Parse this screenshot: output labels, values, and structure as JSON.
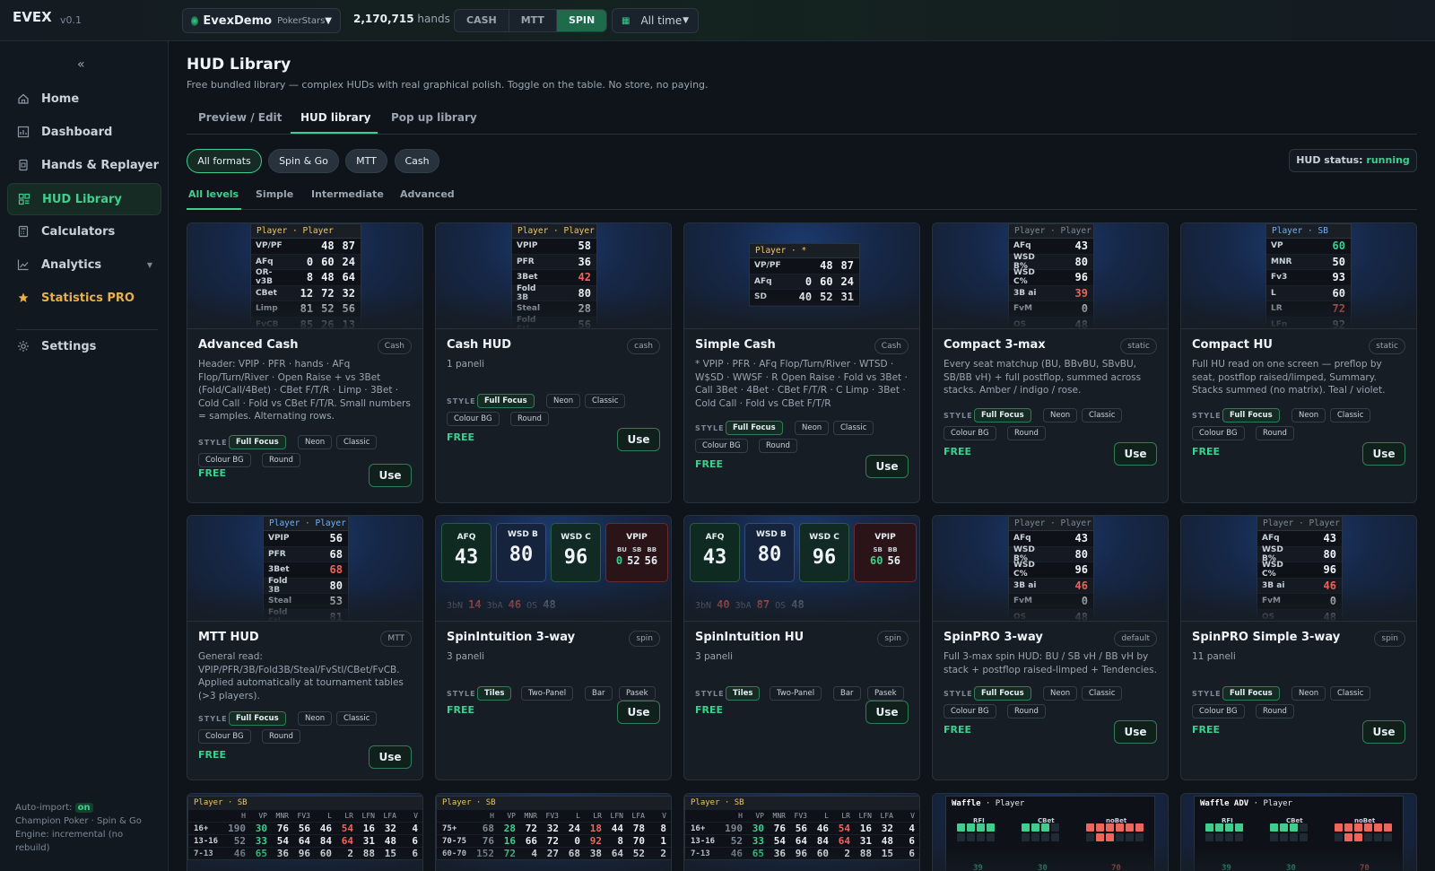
{
  "app": {
    "logo": "EVEX",
    "version": "v0.1"
  },
  "topbar": {
    "account_name": "EvexDemo",
    "account_site": "PokerStars",
    "hands_count": "2,170,715",
    "hands_label": "hands",
    "formats": [
      "CASH",
      "MTT",
      "SPIN"
    ],
    "active_format": "SPIN",
    "date_range": "All time"
  },
  "sidebar": {
    "items": [
      {
        "label": "Home",
        "icon": "home-icon"
      },
      {
        "label": "Dashboard",
        "icon": "dashboard-icon"
      },
      {
        "label": "Hands & Replayer",
        "icon": "replayer-icon"
      },
      {
        "label": "HUD Library",
        "icon": "hud-icon"
      },
      {
        "label": "Calculators",
        "icon": "calculator-icon"
      },
      {
        "label": "Analytics",
        "icon": "analytics-icon"
      },
      {
        "label": "Statistics PRO",
        "icon": "star-icon"
      },
      {
        "label": "Settings",
        "icon": "gear-icon"
      }
    ],
    "footer": {
      "auto_import_label": "Auto-import:",
      "auto_import_value": "on",
      "line2": "Champion Poker · Spin & Go",
      "line3": "Engine: incremental (no rebuild)"
    }
  },
  "page": {
    "title": "HUD Library",
    "subtitle": "Free bundled library — complex HUDs with real graphical polish. Toggle on the table. No store, no paying.",
    "tabs": [
      "Preview / Edit",
      "HUD library",
      "Pop up library"
    ],
    "format_filters": [
      "All formats",
      "Spin & Go",
      "MTT",
      "Cash"
    ],
    "hud_status_label": "HUD status:",
    "hud_status_value": "running",
    "levels": [
      "All levels",
      "Simple",
      "Intermediate",
      "Advanced"
    ]
  },
  "common": {
    "style_label": "STYLE",
    "free_label": "FREE",
    "use_label": "Use"
  },
  "cards": [
    {
      "title": "Advanced Cash",
      "tag": "Cash",
      "desc": "Header: VPIP · PFR · hands · AFq Flop/Turn/River · Open Raise + vs 3Bet (Fold/Call/4Bet) · CBet F/T/R · Limp · 3Bet · Cold Call · Fold vs CBet F/T/R. Small numbers = samples. Alternating rows.",
      "styles": [
        "Full Focus",
        "Neon",
        "Classic",
        "Colour BG",
        "Round"
      ],
      "hud": {
        "header": "Player · Player",
        "rows": [
          [
            "VP/PF",
            "48",
            "87"
          ],
          [
            "AFq",
            "0",
            "60",
            "24"
          ],
          [
            "OR-v3B",
            "8",
            "48",
            "64"
          ],
          [
            "CBet",
            "12",
            "72",
            "32"
          ],
          [
            "Limp",
            "81",
            "52",
            "56"
          ],
          [
            "FvCB",
            "85",
            "26",
            "13"
          ]
        ]
      }
    },
    {
      "title": "Cash HUD",
      "tag": "cash",
      "desc": "1 paneli",
      "styles": [
        "Full Focus",
        "Neon",
        "Classic",
        "Colour BG",
        "Round"
      ],
      "hud": {
        "header": "Player · Player",
        "rows": [
          [
            "VPIP",
            "58"
          ],
          [
            "PFR",
            "36"
          ],
          [
            "3Bet",
            "42"
          ],
          [
            "Fold 3B",
            "80"
          ],
          [
            "Steal",
            "28"
          ],
          [
            "Fold Stl",
            "56"
          ]
        ]
      }
    },
    {
      "title": "Simple Cash",
      "tag": "Cash",
      "desc": "* VPIP · PFR · AFq Flop/Turn/River · WTSD · W$SD · WWSF · R Open Raise · Fold vs 3Bet · Call 3Bet · 4Bet · CBet F/T/R · C Limp · 3Bet · Cold Call · Fold vs CBet F/T/R",
      "styles": [
        "Full Focus",
        "Neon",
        "Classic",
        "Colour BG",
        "Round"
      ],
      "hud": {
        "header": "Player · *",
        "rows": [
          [
            "VP/PF",
            "48",
            "87"
          ],
          [
            "AFq",
            "0",
            "60",
            "24"
          ],
          [
            "SD",
            "40",
            "52",
            "31"
          ]
        ]
      }
    },
    {
      "title": "Compact 3-max",
      "tag": "static",
      "desc": "Every seat matchup (BU, BBvBU, SBvBU, SB/BB vH) + full postflop, summed across stacks. Amber / indigo / rose.",
      "styles": [
        "Full Focus",
        "Neon",
        "Classic",
        "Colour BG",
        "Round"
      ],
      "hud": {
        "header": "Player · Player",
        "rows": [
          [
            "AFq",
            "43"
          ],
          [
            "WSD B%",
            "80"
          ],
          [
            "WSD C%",
            "96"
          ],
          [
            "3B ai",
            "39"
          ],
          [
            "FvM",
            "0"
          ],
          [
            "OS",
            "48"
          ]
        ]
      }
    },
    {
      "title": "Compact HU",
      "tag": "static",
      "desc": "Full HU read on one screen — preflop by seat, postflop raised/limped, Summary. Stacks summed (no matrix). Teal / violet.",
      "styles": [
        "Full Focus",
        "Neon",
        "Classic",
        "Colour BG",
        "Round"
      ],
      "hud": {
        "header": "Player · SB",
        "rows": [
          [
            "VP",
            "60"
          ],
          [
            "MNR",
            "50"
          ],
          [
            "Fv3",
            "93"
          ],
          [
            "L",
            "60"
          ],
          [
            "LR",
            "72"
          ],
          [
            "LFn",
            "92"
          ]
        ]
      }
    },
    {
      "title": "MTT HUD",
      "tag": "MTT",
      "desc": "General read: VPIP/PFR/3B/Fold3B/Steal/FvStl/CBet/FvCB. Applied automatically at tournament tables (>3 players).",
      "styles": [
        "Full Focus",
        "Neon",
        "Classic",
        "Colour BG",
        "Round"
      ],
      "hud": {
        "header": "Player · Player",
        "rows": [
          [
            "VPIP",
            "56"
          ],
          [
            "PFR",
            "68"
          ],
          [
            "3Bet",
            "68"
          ],
          [
            "Fold 3B",
            "80"
          ],
          [
            "Steal",
            "53"
          ],
          [
            "Fold Stl",
            "81"
          ]
        ]
      }
    },
    {
      "title": "SpinIntuition 3-way",
      "tag": "spin",
      "desc": "3 paneli",
      "styles": [
        "Tiles",
        "Two-Panel",
        "Bar",
        "Pasek"
      ],
      "tiles": {
        "afq": "43",
        "wsdb": "80",
        "wsdc": "96",
        "vpip_label": "VPIP",
        "bu": "0",
        "sb": "52",
        "bb": "56",
        "b3n": "14",
        "b3a": "46",
        "os": "48"
      }
    },
    {
      "title": "SpinIntuition HU",
      "tag": "spin",
      "desc": "3 paneli",
      "styles": [
        "Tiles",
        "Two-Panel",
        "Bar",
        "Pasek"
      ],
      "tiles": {
        "afq": "43",
        "wsdb": "80",
        "wsdc": "96",
        "vpip_label": "VPIP",
        "sb": "60",
        "bb": "56",
        "b3n": "40",
        "b3a": "87",
        "os": "48"
      }
    },
    {
      "title": "SpinPRO 3-way",
      "tag": "default",
      "desc": "Full 3-max spin HUD: BU / SB vH / BB vH by stack + postflop raised-limped + Tendencies.",
      "styles": [
        "Full Focus",
        "Neon",
        "Classic",
        "Colour BG",
        "Round"
      ],
      "hud": {
        "header": "Player · Player",
        "rows": [
          [
            "AFq",
            "43"
          ],
          [
            "WSD B%",
            "80"
          ],
          [
            "WSD C%",
            "96"
          ],
          [
            "3B ai",
            "46"
          ],
          [
            "FvM",
            "0"
          ],
          [
            "OS",
            "48"
          ]
        ]
      }
    },
    {
      "title": "SpinPRO Simple 3-way",
      "tag": "spin",
      "desc": "11 paneli",
      "styles": [
        "Full Focus",
        "Neon",
        "Classic",
        "Colour BG",
        "Round"
      ],
      "hud": {
        "header": "Player · Player",
        "rows": [
          [
            "AFq",
            "43"
          ],
          [
            "WSD B%",
            "80"
          ],
          [
            "WSD C%",
            "96"
          ],
          [
            "3B ai",
            "46"
          ],
          [
            "FvM",
            "0"
          ],
          [
            "OS",
            "48"
          ]
        ]
      }
    }
  ],
  "bottom_cards": [
    {
      "header": "Player · SB",
      "cols": [
        "H",
        "VP",
        "MNR",
        "FV3",
        "L",
        "LR",
        "LFN",
        "LFA",
        "V"
      ],
      "rows": [
        [
          "16+",
          "190",
          "30",
          "76",
          "56",
          "46",
          "54",
          "16",
          "32",
          "4"
        ],
        [
          "13-16",
          "52",
          "33",
          "54",
          "64",
          "84",
          "64",
          "31",
          "48",
          "6"
        ],
        [
          "7-13",
          "46",
          "65",
          "36",
          "96",
          "60",
          "2",
          "88",
          "15",
          "6"
        ]
      ]
    },
    {
      "header": "Player · SB",
      "cols": [
        "H",
        "VP",
        "MNR",
        "FV3",
        "L",
        "LR",
        "LFN",
        "LFA",
        "V"
      ],
      "rows": [
        [
          "75+",
          "68",
          "28",
          "72",
          "32",
          "24",
          "18",
          "44",
          "78",
          "8"
        ],
        [
          "70-75",
          "76",
          "16",
          "66",
          "72",
          "0",
          "92",
          "8",
          "70",
          "1"
        ],
        [
          "60-70",
          "152",
          "72",
          "4",
          "27",
          "68",
          "38",
          "64",
          "52",
          "2"
        ]
      ]
    },
    {
      "header": "Player · SB",
      "cols": [
        "H",
        "VP",
        "MNR",
        "FV3",
        "L",
        "LR",
        "LFN",
        "LFA",
        "V"
      ],
      "rows": [
        [
          "16+",
          "190",
          "30",
          "76",
          "56",
          "46",
          "54",
          "16",
          "32",
          "4"
        ],
        [
          "13-16",
          "52",
          "33",
          "54",
          "64",
          "84",
          "64",
          "31",
          "48",
          "6"
        ],
        [
          "7-13",
          "46",
          "65",
          "36",
          "96",
          "60",
          "2",
          "88",
          "15",
          "6"
        ]
      ]
    },
    {
      "name": "Waffle",
      "header": "Player",
      "labels": [
        "RFI",
        "CBet",
        "noBet"
      ],
      "values": [
        "39",
        "30",
        "70"
      ]
    },
    {
      "name": "Waffle ADV",
      "header": "Player",
      "labels": [
        "RFI",
        "CBet",
        "noBet"
      ],
      "values": [
        "39",
        "30",
        "70"
      ]
    }
  ],
  "colors": {
    "accent": "#3ecf8e",
    "pro": "#e8b04a",
    "danger": "#f0655a",
    "bg": "#0e1419"
  }
}
